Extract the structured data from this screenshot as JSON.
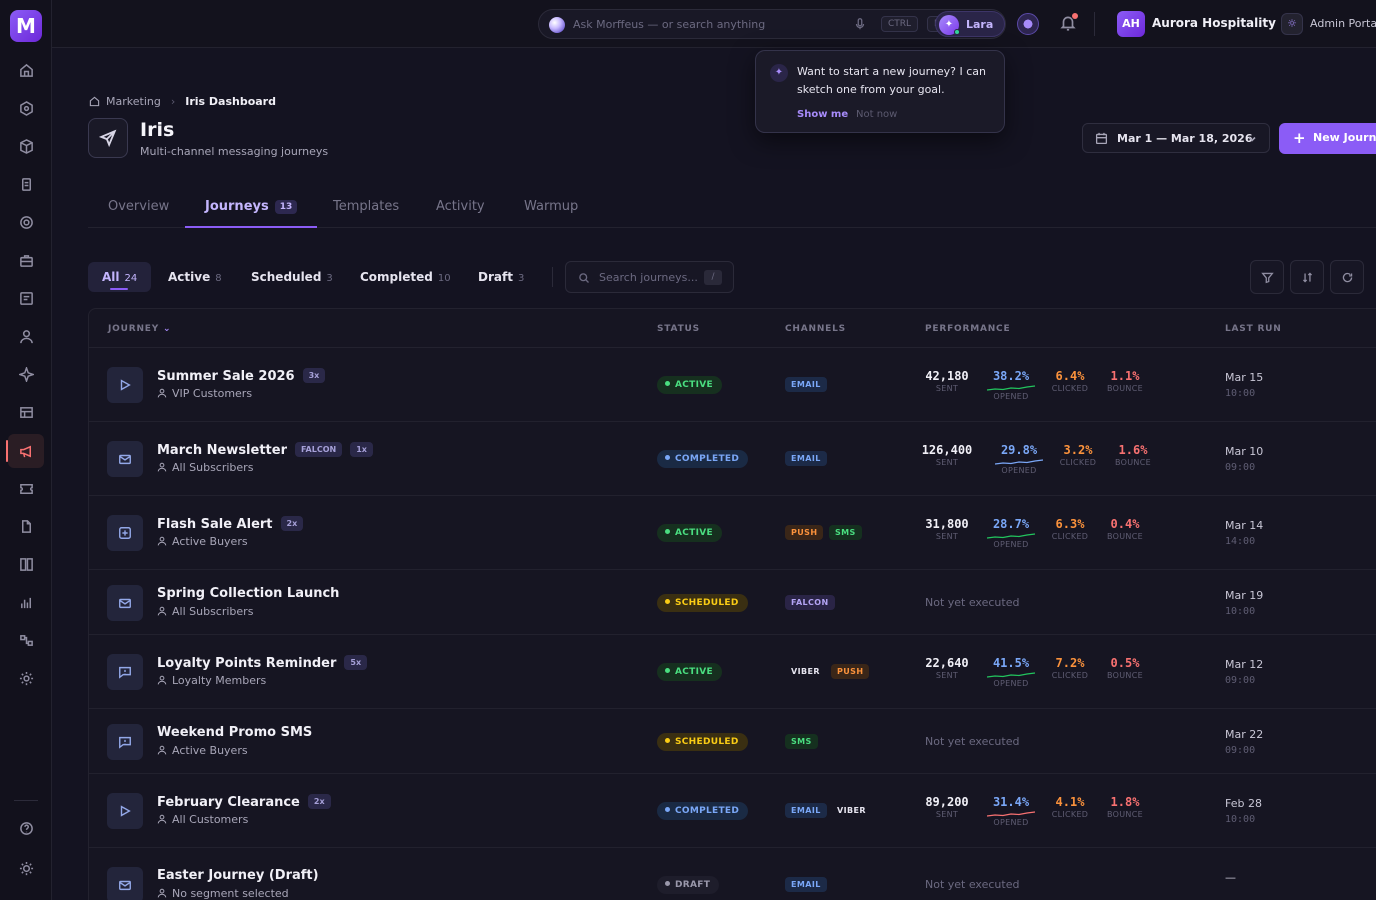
{
  "sidebar": {
    "logo": "M",
    "items": [
      "home-icon",
      "compass-icon",
      "cube-icon",
      "document-icon",
      "globe-icon",
      "briefcase-icon",
      "list-icon",
      "user-icon",
      "sparkle-icon",
      "table-icon",
      "megaphone-icon",
      "ticket-icon",
      "file-icon",
      "grid-icon",
      "chart-icon",
      "flow-icon",
      "settings-icon"
    ],
    "active_item": "megaphone-icon",
    "bottom": [
      "help-icon",
      "sun-icon"
    ]
  },
  "topbar": {
    "search_placeholder": "Ask Morffeus — or search anything",
    "kbd_ctrl": "CTRL",
    "kbd_k": "K",
    "assistant_name": "Lara",
    "org_initials": "AH",
    "org_name": "Aurora Hospitality",
    "separator": "·",
    "admin_label": "Admin Portal"
  },
  "popover": {
    "text": "Want to start a new journey? I can sketch one from your goal.",
    "primary": "Show me",
    "secondary": "Not now"
  },
  "breadcrumb": {
    "parent": "Marketing",
    "current": "Iris Dashboard"
  },
  "page": {
    "title": "Iris",
    "subtitle": "Multi-channel messaging journeys",
    "date_range": "Mar 1 — Mar 18, 2026",
    "new_button": "New Journey"
  },
  "tabs": [
    {
      "label": "Overview"
    },
    {
      "label": "Journeys",
      "count": "13",
      "active": true
    },
    {
      "label": "Templates"
    },
    {
      "label": "Activity"
    },
    {
      "label": "Warmup"
    }
  ],
  "filters": [
    {
      "label": "All",
      "count": "24",
      "active": true
    },
    {
      "label": "Active",
      "count": "8"
    },
    {
      "label": "Scheduled",
      "count": "3"
    },
    {
      "label": "Completed",
      "count": "10"
    },
    {
      "label": "Draft",
      "count": "3"
    }
  ],
  "journey_search": {
    "placeholder": "Search journeys...",
    "shortcut": "/"
  },
  "table": {
    "headers": {
      "journey": "JOURNEY",
      "status": "STATUS",
      "channels": "CHANNELS",
      "performance": "PERFORMANCE",
      "last_run": "LAST RUN"
    },
    "metric_labels": {
      "sent": "SENT",
      "opened": "OPENED",
      "clicked": "CLICKED",
      "bounce": "BOUNCE"
    },
    "rows": [
      {
        "icon": "play-icon",
        "name": "Summer Sale 2026",
        "tags": [
          "3x"
        ],
        "segment": "VIP Customers",
        "status": "ACTIVE",
        "status_type": "active",
        "channels": [
          "EMAIL"
        ],
        "sent": "42,180",
        "opened": "38.2%",
        "clicked": "6.4%",
        "bounce": "1.1%",
        "spark_color": "#22c55e",
        "last_date": "Mar 15",
        "last_time": "10:00"
      },
      {
        "icon": "mail-icon",
        "name": "March Newsletter",
        "tags": [
          "FALCON",
          "1x"
        ],
        "segment": "All Subscribers",
        "status": "COMPLETED",
        "status_type": "completed",
        "channels": [
          "EMAIL"
        ],
        "sent": "126,400",
        "opened": "29.8%",
        "clicked": "3.2%",
        "bounce": "1.6%",
        "spark_color": "#7aa7f7",
        "last_date": "Mar 10",
        "last_time": "09:00"
      },
      {
        "icon": "bolt-icon",
        "name": "Flash Sale Alert",
        "tags": [
          "2x"
        ],
        "segment": "Active Buyers",
        "status": "ACTIVE",
        "status_type": "active",
        "channels": [
          "PUSH",
          "SMS"
        ],
        "sent": "31,800",
        "opened": "28.7%",
        "clicked": "6.3%",
        "bounce": "0.4%",
        "spark_color": "#22c55e",
        "last_date": "Mar 14",
        "last_time": "14:00"
      },
      {
        "icon": "mail-icon",
        "name": "Spring Collection Launch",
        "tags": [],
        "segment": "All Subscribers",
        "status": "SCHEDULED",
        "status_type": "scheduled",
        "channels": [
          "FALCON"
        ],
        "not_executed": "Not yet executed",
        "last_date": "Mar 19",
        "last_time": "10:00"
      },
      {
        "icon": "chat-icon",
        "name": "Loyalty Points Reminder",
        "tags": [
          "5x"
        ],
        "segment": "Loyalty Members",
        "status": "ACTIVE",
        "status_type": "active",
        "channels": [
          "VIBER",
          "PUSH"
        ],
        "sent": "22,640",
        "opened": "41.5%",
        "clicked": "7.2%",
        "bounce": "0.5%",
        "spark_color": "#22c55e",
        "last_date": "Mar 12",
        "last_time": "09:00"
      },
      {
        "icon": "chat-icon",
        "name": "Weekend Promo SMS",
        "tags": [],
        "segment": "Active Buyers",
        "status": "SCHEDULED",
        "status_type": "scheduled",
        "channels": [
          "SMS"
        ],
        "not_executed": "Not yet executed",
        "last_date": "Mar 22",
        "last_time": "09:00"
      },
      {
        "icon": "play-icon",
        "name": "February Clearance",
        "tags": [
          "2x"
        ],
        "segment": "All Customers",
        "status": "COMPLETED",
        "status_type": "completed",
        "channels": [
          "EMAIL",
          "VIBER"
        ],
        "sent": "89,200",
        "opened": "31.4%",
        "clicked": "4.1%",
        "bounce": "1.8%",
        "spark_color": "#f87171",
        "last_date": "Feb 28",
        "last_time": "10:00"
      },
      {
        "icon": "mail-icon",
        "name": "Easter Journey (Draft)",
        "tags": [],
        "segment": "No segment selected",
        "status": "DRAFT",
        "status_type": "draft",
        "channels": [
          "EMAIL"
        ],
        "not_executed": "Not yet executed",
        "last_date": "—",
        "last_time": ""
      }
    ]
  }
}
